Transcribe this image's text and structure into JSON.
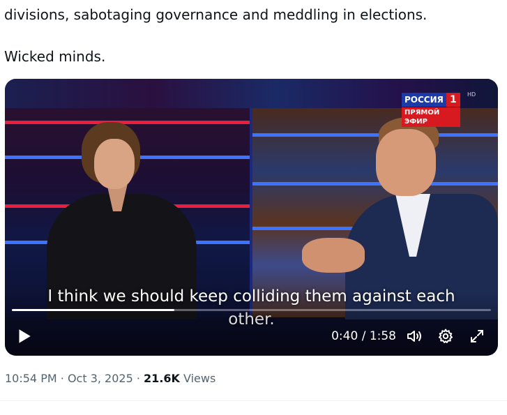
{
  "tweet": {
    "text_line1": "divisions, sabotaging governance and meddling in elections.",
    "text_line2": "Wicked minds."
  },
  "video": {
    "channel_logo": {
      "name": "РОССИЯ",
      "number": "1",
      "hd": "HD",
      "subtitle": "ПРЯМОЙ ЭФИР",
      "brand_blue": "#1c3aa8",
      "brand_red": "#d71920"
    },
    "captions": [
      "I think we should keep colliding them against each",
      "other."
    ],
    "current_time": "0:40",
    "duration": "1:58",
    "time_display": "0:40 / 1:58",
    "progress_fraction": 0.339,
    "icons": {
      "play": "play-icon",
      "volume": "volume-icon",
      "settings": "gear-icon",
      "fullscreen": "expand-icon"
    }
  },
  "meta": {
    "time": "10:54 PM",
    "date": "Oct 3, 2025",
    "views_count": "21.6K",
    "views_label": "Views",
    "separator": "·"
  }
}
